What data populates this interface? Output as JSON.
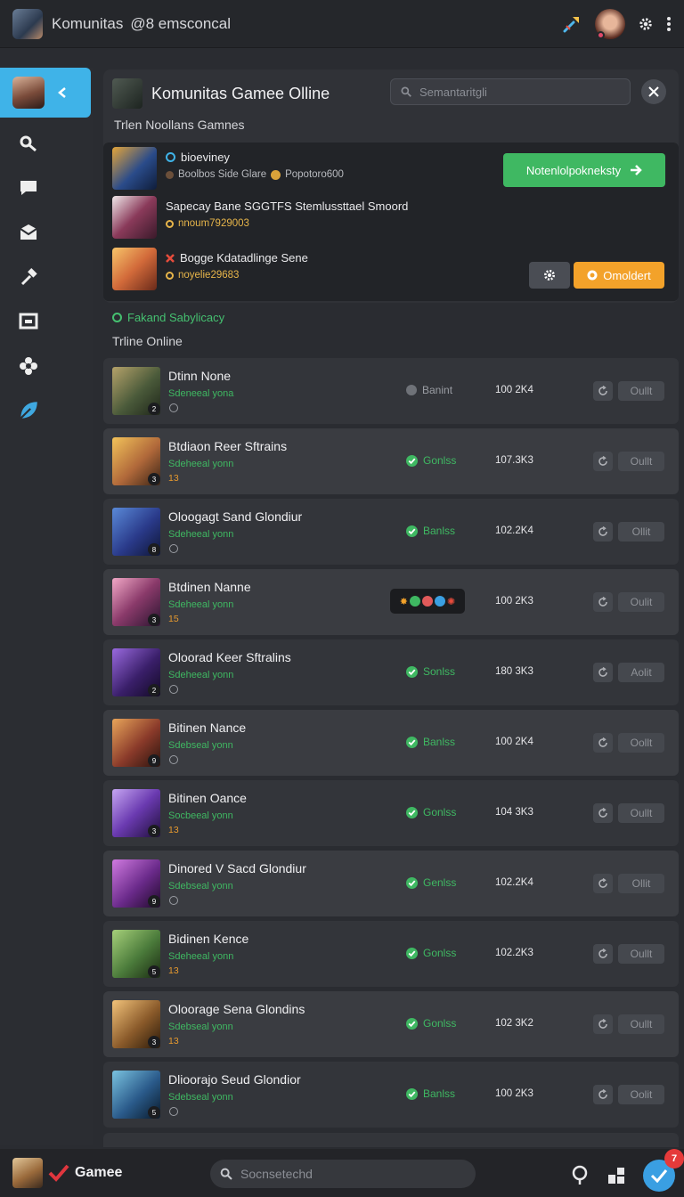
{
  "topbar": {
    "title": "Komunitas",
    "handle": "@8 emsconcal"
  },
  "panel": {
    "title": "Komunitas Gamee Olline",
    "search_placeholder": "Semantaritgli",
    "subhead": "Trlen Noollans Gamnes"
  },
  "friends": [
    {
      "name": "bioeviney",
      "sub": "Boolbos Side Glare",
      "sub2": "Popotoro600",
      "icon": "online-ring-icon"
    },
    {
      "name": "Sapecay Bane SGGTFS Stemlussttael Smoord",
      "sub": "nnoum7929003",
      "icon": ""
    },
    {
      "name": "Bogge Kdatadlinge Sene",
      "sub": "noyelie29683",
      "icon": "x-icon"
    }
  ],
  "actions": {
    "green_label": "Notenlolpokneksty",
    "orange_label": "Omoldert"
  },
  "privacy_label": "Fakand Sabylicacy",
  "online_head": "Trline Online",
  "rows": [
    {
      "name": "Dtinn None",
      "sub": "Sdeneeal yona",
      "extra": "",
      "status": "Banint",
      "status_kind": "grey",
      "count": "100 2K4",
      "btn": "Oullt",
      "num": "2"
    },
    {
      "name": "Btdiaon Reer Sftrains",
      "sub": "Sdeheeal yonn",
      "extra": "13",
      "status": "Gonlss",
      "status_kind": "green",
      "count": "107.3K3",
      "btn": "Oullt",
      "num": "3"
    },
    {
      "name": "Oloogagt Sand Glondiur",
      "sub": "Sdeheeal yonn",
      "extra": "",
      "status": "Banlss",
      "status_kind": "green",
      "count": "102.2K4",
      "btn": "Ollit",
      "num": "8"
    },
    {
      "name": "Btdinen Nanne",
      "sub": "Sdeheeal yonn",
      "extra": "15",
      "status": "",
      "status_kind": "emoji",
      "count": "100 2K3",
      "btn": "Oulit",
      "num": "3"
    },
    {
      "name": "Oloorad Keer Sftralins",
      "sub": "Sdeheeal yonn",
      "extra": "",
      "status": "Sonlss",
      "status_kind": "green",
      "count": "180 3K3",
      "btn": "Aolit",
      "num": "2"
    },
    {
      "name": "Bitinen Nance",
      "sub": "Sdebseal yonn",
      "extra": "",
      "status": "Banlss",
      "status_kind": "green",
      "count": "100 2K4",
      "btn": "Oollt",
      "num": "9"
    },
    {
      "name": "Bitinen Oance",
      "sub": "Socbeeal yonn",
      "extra": "13",
      "status": "Gonlss",
      "status_kind": "green",
      "count": "104 3K3",
      "btn": "Oullt",
      "num": "3"
    },
    {
      "name": "Dinored V Sacd Glondiur",
      "sub": "Sdebseal yonn",
      "extra": "",
      "status": "Genlss",
      "status_kind": "green",
      "count": "102.2K4",
      "btn": "Ollit",
      "num": "9"
    },
    {
      "name": "Bidinen Kence",
      "sub": "Sdeheeal yonn",
      "extra": "13",
      "status": "Gonlss",
      "status_kind": "green",
      "count": "102.2K3",
      "btn": "Oullt",
      "num": "5"
    },
    {
      "name": "Oloorage Sena Glondins",
      "sub": "Sdebseal yonn",
      "extra": "13",
      "status": "Gonlss",
      "status_kind": "green",
      "count": "102 3K2",
      "btn": "Oullt",
      "num": "3"
    },
    {
      "name": "Dlioorajo Seud Glondior",
      "sub": "Sdebseal yonn",
      "extra": "",
      "status": "Banlss",
      "status_kind": "green",
      "count": "100 2K3",
      "btn": "Oolit",
      "num": "5"
    }
  ],
  "bottombar": {
    "label": "Gamee",
    "search_placeholder": "Socnsetechd",
    "badge": "7"
  },
  "colors": {
    "accent_blue": "#3fb3e8",
    "green": "#3fb862",
    "orange": "#f3a22a",
    "badge_red": "#e53a3a"
  }
}
